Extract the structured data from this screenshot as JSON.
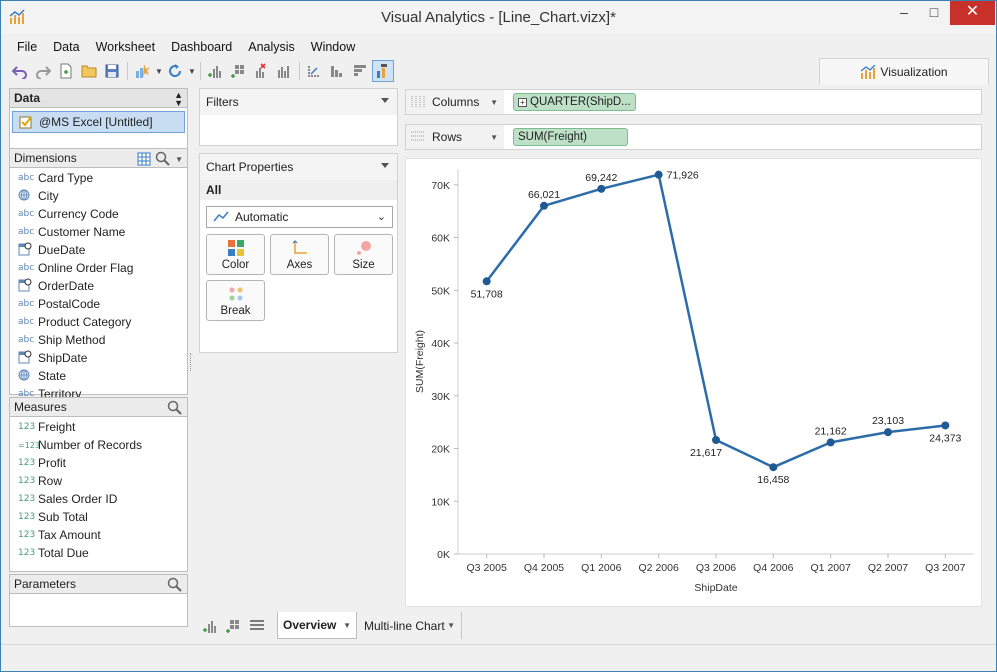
{
  "window": {
    "title": "Visual Analytics - [Line_Chart.vizx]*"
  },
  "menu": [
    "File",
    "Data",
    "Worksheet",
    "Dashboard",
    "Analysis",
    "Window"
  ],
  "viz_tab": "Visualization",
  "data_pane": {
    "title": "Data",
    "data_source": "@MS Excel [Untitled]",
    "dimensions_title": "Dimensions",
    "dimensions": [
      {
        "type": "abc",
        "name": "Card Type"
      },
      {
        "type": "geo",
        "name": "City"
      },
      {
        "type": "abc",
        "name": "Currency Code"
      },
      {
        "type": "abc",
        "name": "Customer Name"
      },
      {
        "type": "date",
        "name": "DueDate"
      },
      {
        "type": "abc",
        "name": "Online Order Flag"
      },
      {
        "type": "date",
        "name": "OrderDate"
      },
      {
        "type": "abc",
        "name": "PostalCode"
      },
      {
        "type": "abc",
        "name": "Product Category"
      },
      {
        "type": "abc",
        "name": "Ship Method"
      },
      {
        "type": "date",
        "name": "ShipDate"
      },
      {
        "type": "geo",
        "name": "State"
      },
      {
        "type": "abc",
        "name": "Territory"
      }
    ],
    "measures_title": "Measures",
    "measures": [
      {
        "type": "123",
        "name": "Freight"
      },
      {
        "type": "=123",
        "name": "Number of Records"
      },
      {
        "type": "123",
        "name": "Profit"
      },
      {
        "type": "123",
        "name": "Row"
      },
      {
        "type": "123",
        "name": "Sales Order ID"
      },
      {
        "type": "123",
        "name": "Sub Total"
      },
      {
        "type": "123",
        "name": "Tax Amount"
      },
      {
        "type": "123",
        "name": "Total Due"
      }
    ],
    "parameters_title": "Parameters"
  },
  "filters": {
    "title": "Filters"
  },
  "chart_properties": {
    "title": "Chart Properties",
    "all_label": "All",
    "mark_type": "Automatic",
    "buttons": [
      "Color",
      "Axes",
      "Size",
      "Break"
    ]
  },
  "shelves": {
    "columns_label": "Columns",
    "columns_pill": "QUARTER(ShipD...",
    "rows_label": "Rows",
    "rows_pill": "SUM(Freight)"
  },
  "chart_data": {
    "type": "line",
    "xlabel": "ShipDate",
    "ylabel": "SUM(Freight)",
    "categories": [
      "Q3 2005",
      "Q4 2005",
      "Q1 2006",
      "Q2 2006",
      "Q3 2006",
      "Q4 2006",
      "Q1 2007",
      "Q2 2007",
      "Q3 2007"
    ],
    "values": [
      51708,
      66021,
      69242,
      71926,
      21617,
      16458,
      21162,
      23103,
      24373
    ],
    "data_labels": [
      "51,708",
      "66,021",
      "69,242",
      "71,926",
      "21,617",
      "16,458",
      "21,162",
      "23,103",
      "24,373"
    ],
    "yticks": [
      0,
      10000,
      20000,
      30000,
      40000,
      50000,
      60000,
      70000
    ],
    "ytick_labels": [
      "0K",
      "10K",
      "20K",
      "30K",
      "40K",
      "50K",
      "60K",
      "70K"
    ],
    "ylim": [
      0,
      73000
    ],
    "color": "#2c6ca8",
    "grid": false
  },
  "sheet_tabs": [
    "Overview",
    "Multi-line Chart"
  ]
}
